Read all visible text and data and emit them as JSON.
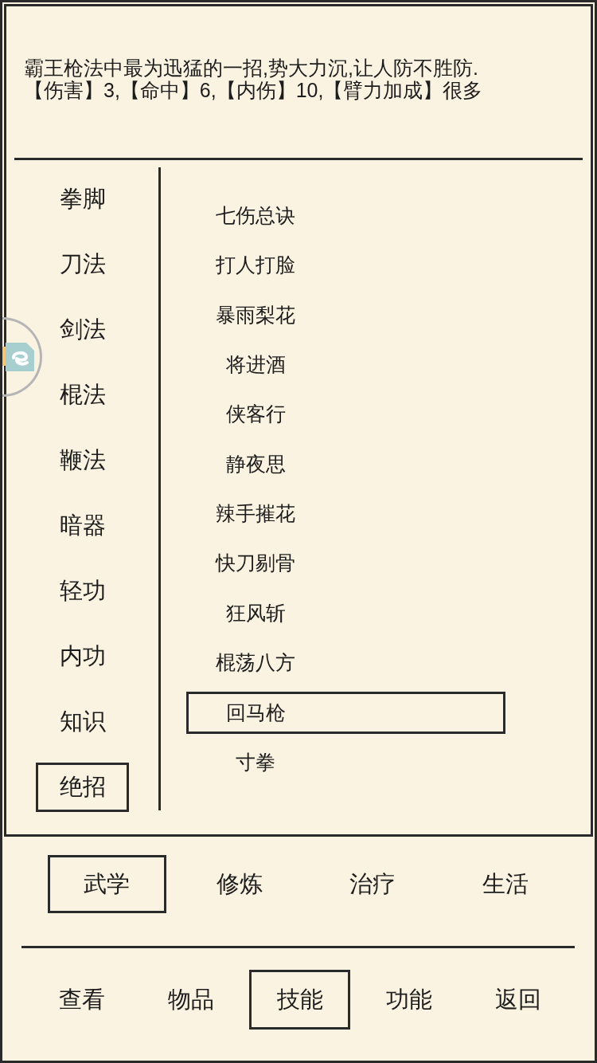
{
  "info": {
    "description": "霸王枪法中最为迅猛的一招,势大力沉,让人防不胜防.",
    "stats": "【伤害】3,【命中】6,【内伤】10,【臂力加成】很多"
  },
  "categories": [
    {
      "label": "拳脚",
      "selected": false
    },
    {
      "label": "刀法",
      "selected": false
    },
    {
      "label": "剑法",
      "selected": false
    },
    {
      "label": "棍法",
      "selected": false
    },
    {
      "label": "鞭法",
      "selected": false
    },
    {
      "label": "暗器",
      "selected": false
    },
    {
      "label": "轻功",
      "selected": false
    },
    {
      "label": "内功",
      "selected": false
    },
    {
      "label": "知识",
      "selected": false
    },
    {
      "label": "绝招",
      "selected": true
    }
  ],
  "skills": [
    {
      "label": "七伤总诀",
      "selected": false
    },
    {
      "label": "打人打脸",
      "selected": false
    },
    {
      "label": "暴雨梨花",
      "selected": false
    },
    {
      "label": "将进酒",
      "selected": false
    },
    {
      "label": "侠客行",
      "selected": false
    },
    {
      "label": "静夜思",
      "selected": false
    },
    {
      "label": "辣手摧花",
      "selected": false
    },
    {
      "label": "快刀剔骨",
      "selected": false
    },
    {
      "label": "狂风斩",
      "selected": false
    },
    {
      "label": "棍荡八方",
      "selected": false
    },
    {
      "label": "回马枪",
      "selected": true
    },
    {
      "label": "寸拳",
      "selected": false
    }
  ],
  "sub_tabs": [
    {
      "label": "武学",
      "selected": true
    },
    {
      "label": "修炼",
      "selected": false
    },
    {
      "label": "治疗",
      "selected": false
    },
    {
      "label": "生活",
      "selected": false
    }
  ],
  "nav": [
    {
      "label": "查看",
      "selected": false
    },
    {
      "label": "物品",
      "selected": false
    },
    {
      "label": "技能",
      "selected": true
    },
    {
      "label": "功能",
      "selected": false
    },
    {
      "label": "返回",
      "selected": false
    }
  ]
}
